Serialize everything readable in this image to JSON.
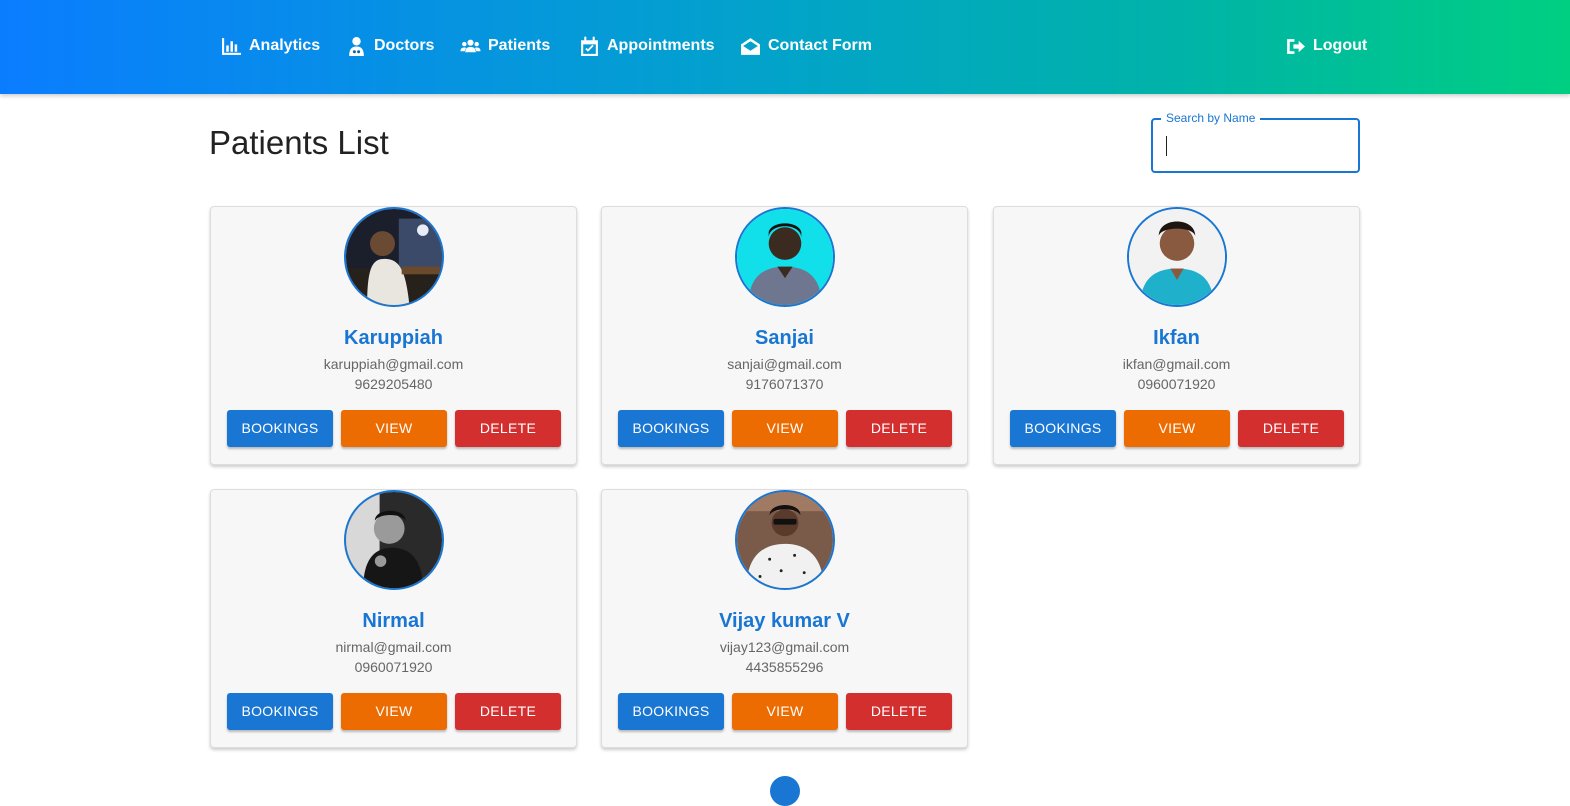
{
  "nav": {
    "items": [
      {
        "label": "Analytics",
        "icon": "bar-chart-icon"
      },
      {
        "label": "Doctors",
        "icon": "doctor-icon"
      },
      {
        "label": "Patients",
        "icon": "users-icon"
      },
      {
        "label": "Appointments",
        "icon": "calendar-check-icon"
      },
      {
        "label": "Contact Form",
        "icon": "envelope-open-icon"
      }
    ],
    "logout": {
      "label": "Logout",
      "icon": "sign-out-icon"
    }
  },
  "page": {
    "title": "Patients List"
  },
  "search": {
    "label": "Search by Name",
    "value": ""
  },
  "patients": [
    {
      "name": "Karuppiah",
      "email": "karuppiah@gmail.com",
      "phone": "9629205480"
    },
    {
      "name": "Sanjai",
      "email": "sanjai@gmail.com",
      "phone": "9176071370"
    },
    {
      "name": "Ikfan",
      "email": "ikfan@gmail.com",
      "phone": "0960071920"
    },
    {
      "name": "Nirmal",
      "email": "nirmal@gmail.com",
      "phone": "0960071920"
    },
    {
      "name": "Vijay kumar V",
      "email": "vijay123@gmail.com",
      "phone": "4435855296"
    }
  ],
  "actions": {
    "bookings": "BOOKINGS",
    "view": "VIEW",
    "delete": "DELETE"
  },
  "colors": {
    "primary": "#1976d2",
    "warning": "#ed6c02",
    "error": "#d32f2f",
    "header_start": "#0a7dff",
    "header_end": "#00cf82"
  }
}
